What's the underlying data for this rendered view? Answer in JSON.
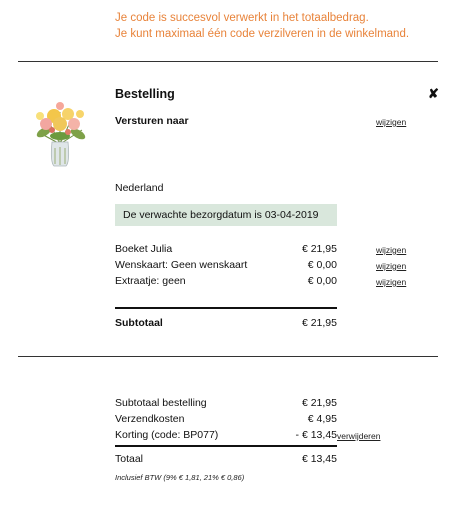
{
  "notice": {
    "line1": "Je code is succesvol verwerkt in het totaalbedrag.",
    "line2": "Je kunt maximaal één code verzilveren in de winkelmand."
  },
  "order": {
    "title": "Bestelling",
    "ship_to_label": "Versturen naar",
    "edit_label": "wijzigen",
    "country": "Nederland",
    "delivery_date_text": "De verwachte bezorgdatum is 03-04-2019",
    "items": [
      {
        "label": "Boeket Julia",
        "price": "€ 21,95",
        "action": "wijzigen"
      },
      {
        "label": "Wenskaart: Geen wenskaart",
        "price": "€ 0,00",
        "action": "wijzigen"
      },
      {
        "label": "Extraatje: geen",
        "price": "€ 0,00",
        "action": "wijzigen"
      }
    ],
    "subtotal_label": "Subtotaal",
    "subtotal_value": "€ 21,95"
  },
  "summary": {
    "subtotal_label": "Subtotaal bestelling",
    "subtotal_value": "€ 21,95",
    "shipping_label": "Verzendkosten",
    "shipping_value": "€ 4,95",
    "discount_label": "Korting (code: BP077)",
    "discount_value": "- € 13,45",
    "remove_label": "verwijderen",
    "total_label": "Totaal",
    "total_value": "€ 13,45",
    "vat_note": "Inclusief BTW (9% € 1,81, 21% € 0,86)"
  },
  "close_symbol": "✘",
  "colors": {
    "notice": "#e8833a",
    "delivery_bg": "#d9e7dc"
  }
}
